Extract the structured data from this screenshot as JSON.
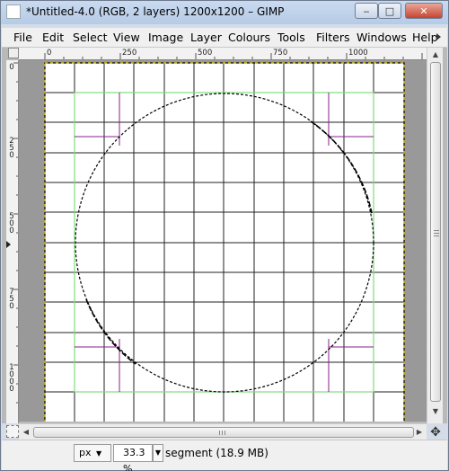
{
  "window": {
    "title": "*Untitled-4.0 (RGB, 2 layers) 1200x1200 – GIMP",
    "minimize": "‒",
    "maximize": "□",
    "close": "✕"
  },
  "menu": [
    "File",
    "Edit",
    "Select",
    "View",
    "Image",
    "Layer",
    "Colours",
    "Tools",
    "Filters",
    "Windows",
    "Help"
  ],
  "ruler": {
    "horizontal": [
      "0",
      "250",
      "500",
      "750",
      "1000"
    ],
    "vertical": [
      "0",
      "250",
      "500",
      "750",
      "1000"
    ]
  },
  "statusbar": {
    "unit": "px",
    "zoom": "33.3 %",
    "message": "segment (18.9 MB)"
  },
  "icons": {
    "navigate": "move-icon",
    "quick_mask": "quick-mask-icon"
  },
  "colors": {
    "guide_green": "#7fdc7f",
    "cross_purple": "#8a1f8a",
    "layer_boundary": "#d9c400"
  }
}
